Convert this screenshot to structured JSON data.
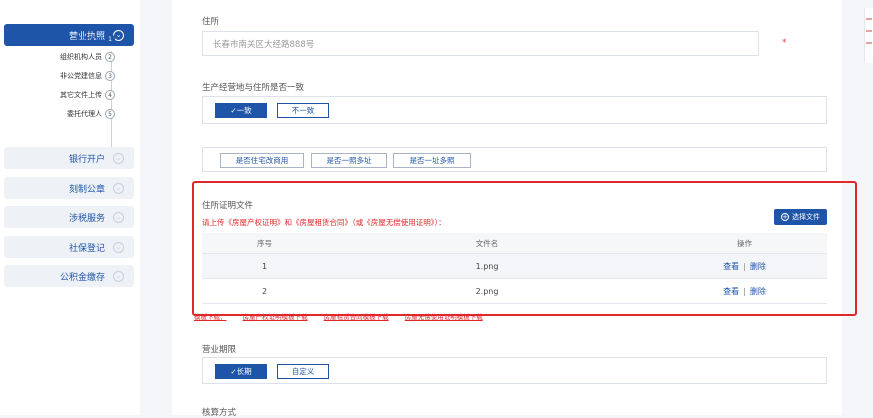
{
  "sidebar": {
    "sections": [
      {
        "label": "营业执照",
        "active": true
      },
      {
        "label": "银行开户",
        "active": false
      },
      {
        "label": "刻制公章",
        "active": false
      },
      {
        "label": "涉税服务",
        "active": false
      },
      {
        "label": "社保登记",
        "active": false
      },
      {
        "label": "公积金缴存",
        "active": false
      }
    ],
    "steps": [
      {
        "label": "基本信息",
        "num": "1",
        "active": true
      },
      {
        "label": "组织机构人员",
        "num": "2"
      },
      {
        "label": "非公党建信息",
        "num": "3"
      },
      {
        "label": "其它文件上传",
        "num": "4"
      },
      {
        "label": "委托代理人",
        "num": "5"
      }
    ],
    "chevron": "⌄"
  },
  "form": {
    "address": {
      "label": "住所",
      "value": "长春市南关区大经路888号",
      "required_mark": "*"
    },
    "consistency": {
      "label": "生产经营地与住所是否一致",
      "options": [
        "✓一致",
        "不一致"
      ],
      "selected": "✓一致"
    },
    "residence_options": {
      "buttons": [
        "是否住宅改商用",
        "是否一照多址",
        "是否一址多照"
      ]
    },
    "proof_files": {
      "label": "住所证明文件",
      "instruction": "请上传《房屋产权证明》和《房屋租赁合同》（或《房屋无偿使用证明》）：",
      "select_button": "选择文件",
      "columns": [
        "序号",
        "文件名",
        "操作"
      ],
      "rows": [
        {
          "index": "1",
          "filename": "1.png",
          "view": "查看",
          "sep": "|",
          "delete": "删除"
        },
        {
          "index": "2",
          "filename": "2.png",
          "view": "查看",
          "sep": "|",
          "delete": "删除"
        }
      ],
      "downloads": [
        "模板下载：",
        "房屋产权证明模板下载",
        "房屋租赁合同模板下载",
        "房屋无偿使用证明模板下载"
      ]
    },
    "business_term": {
      "label": "营业期限",
      "options": [
        "✓长期",
        "自定义"
      ],
      "selected": "✓长期"
    },
    "next_label": "核算方式"
  }
}
